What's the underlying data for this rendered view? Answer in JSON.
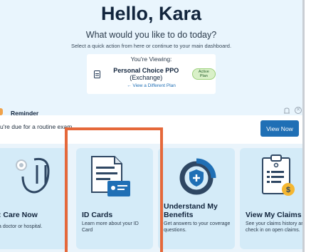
{
  "hero": {
    "greeting": "Hello, Kara",
    "question": "What would you like to do today?",
    "subtitle": "Select a quick action from here or continue to your main dashboard."
  },
  "plan": {
    "viewing_label": "You're Viewing:",
    "name_bold": "Personal Choice PPO",
    "name_suffix": " (Exchange)",
    "badge": "Active Plan",
    "change_link": "← View a Different Plan"
  },
  "reminder": {
    "title": "Reminder",
    "text": "u're due for a routine exam.",
    "button": "View Now"
  },
  "tiles": [
    {
      "title": ": Care Now",
      "desc": "a doctor or hospital."
    },
    {
      "title": "ID Cards",
      "desc": "Learn more about your ID Card"
    },
    {
      "title": "Understand My Benefits",
      "desc": "Get answers to your coverage questions."
    },
    {
      "title": "View My Claims",
      "desc": "See your claims history and check in on open claims."
    }
  ],
  "colors": {
    "hero_bg": "#e9f5fd",
    "primary": "#1f6fb5",
    "tile_bg": "#d4ebf8",
    "highlight": "#e5683a",
    "badge_bg": "#d9f0c8"
  }
}
